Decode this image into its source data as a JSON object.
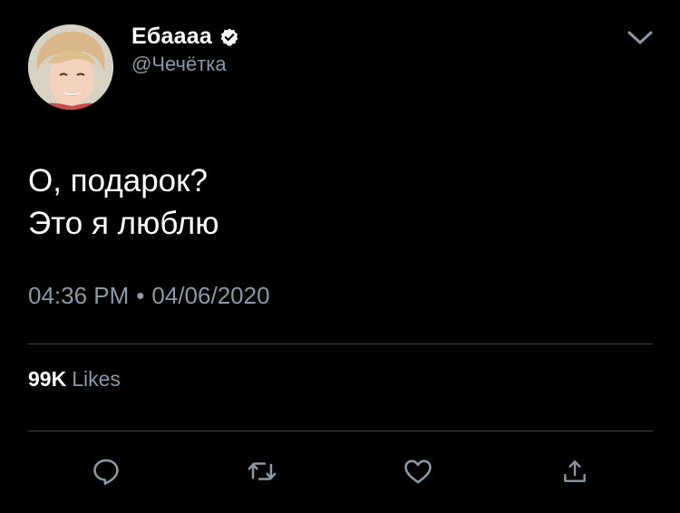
{
  "tweet": {
    "display_name": "Ебаааа",
    "handle": "@Чечётка",
    "verified": true,
    "text_lines": [
      "О, подарок?",
      "Это я люблю"
    ],
    "time": "04:36 PM",
    "separator": "•",
    "date": "04/06/2020",
    "likes_count": "99K",
    "likes_label": "Likes"
  },
  "icons": {
    "verified": "verified-badge-icon",
    "menu": "chevron-down-icon",
    "reply": "reply-icon",
    "retweet": "retweet-icon",
    "like": "heart-icon",
    "share": "share-icon"
  },
  "colors": {
    "background": "#000000",
    "text_primary": "#ffffff",
    "text_secondary": "#8b98a5",
    "divider": "#3d4248"
  }
}
